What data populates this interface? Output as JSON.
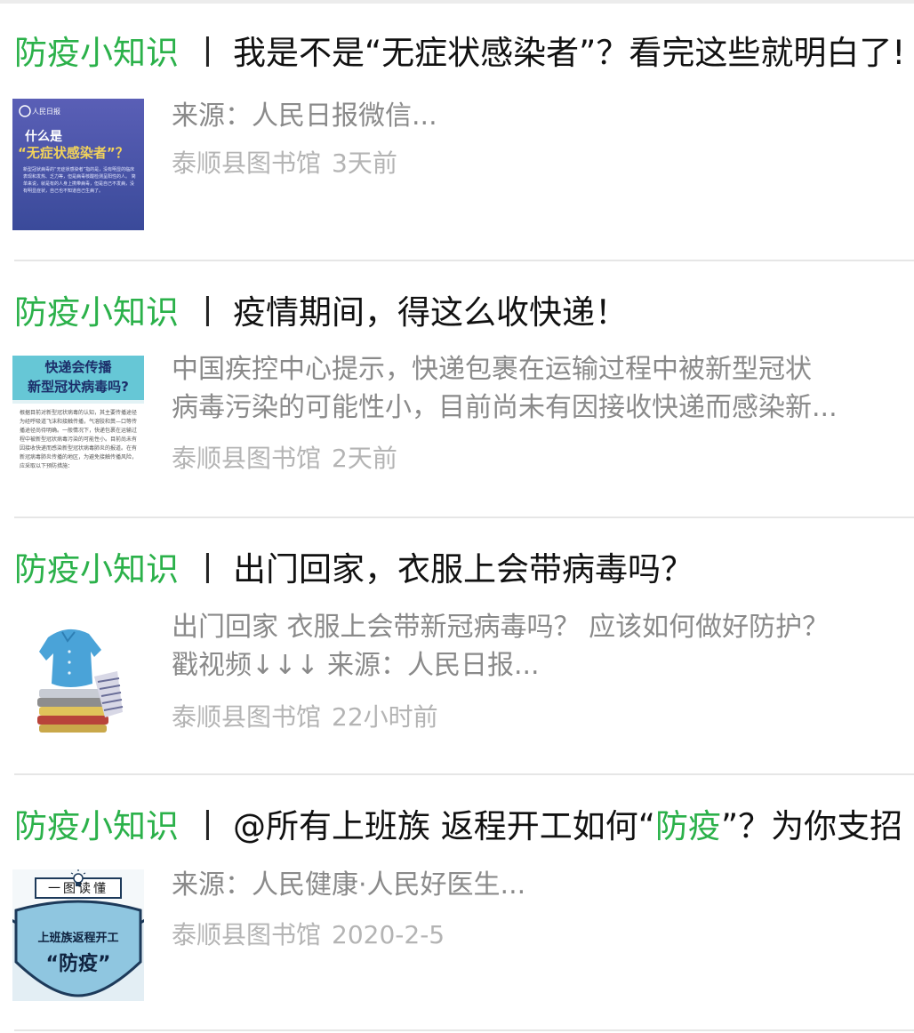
{
  "articles": [
    {
      "tag": "防疫小知识",
      "separator": "丨",
      "title": "我是不是“无症状感染者”？看完这些就明白了!",
      "summary_lines": [
        "来源：人民日报微信..."
      ],
      "author": "泰顺县图书馆",
      "time": "3天前",
      "thumb": {
        "logo": "人民日报",
        "q1": "什么是",
        "q2": "“无症状感染者”？",
        "body": "新型冠状病毒的“无症状感染者”指的是，没有明显的临床表现和发热、乏力等，但是病毒核酸检测呈阳性的人。 简单来说，就是有的人身上携带病毒，但是自己不发病，没有明显症状，自己也不知道自己生病了。"
      }
    },
    {
      "tag": "防疫小知识",
      "separator": "丨",
      "title": "疫情期间，得这么收快递！",
      "summary_lines": [
        "中国疾控中心提示，快递包裹在运输过程中被新型冠状",
        "病毒污染的可能性小，目前尚未有因接收快递而感染新..."
      ],
      "author": "泰顺县图书馆",
      "time": "2天前",
      "thumb": {
        "h1": "快递会传播",
        "h2": "新型冠状病毒吗?",
        "body": "根据目前对新型冠状病毒的认知，其主要传播途径为经呼吸道飞沫和接触传播，气溶胶和粪—口等传播途径尚待明确。一般情况下，快递包裹在运输过程中被新型冠状病毒污染的可能性小。目前尚未有因接收快递而感染新型冠状病毒肺炎的报道。在有新冠病毒肺炎传播的地区，为避免接触传播风险，应采取以下预防措施："
      }
    },
    {
      "tag": "防疫小知识",
      "separator": "丨",
      "title": "出门回家，衣服上会带病毒吗？",
      "summary_lines": [
        "出门回家 衣服上会带新冠病毒吗？ 应该如何做好防护？",
        "戳视频↓↓↓ 来源：人民日报..."
      ],
      "author": "泰顺县图书馆",
      "time": "22小时前",
      "thumb": {}
    },
    {
      "tag": "防疫小知识",
      "separator": "丨",
      "title_pre": "@所有上班族 返程开工如何“",
      "title_hl": "防疫",
      "title_post": "”？为你支招",
      "summary_lines": [
        "来源：人民健康·人民好医生..."
      ],
      "author": "泰顺县图书馆",
      "time": "2020-2-5",
      "thumb": {
        "banner": "一图读懂",
        "l1": "上班族返程开工",
        "l2": "“防疫”"
      }
    }
  ],
  "colors": {
    "tag_green": "#2bb14a",
    "meta_gray": "#b4b4b4",
    "summary_gray": "#8a8a8a"
  },
  "icons": [
    "lightbulb-icon",
    "shirt-icon"
  ]
}
